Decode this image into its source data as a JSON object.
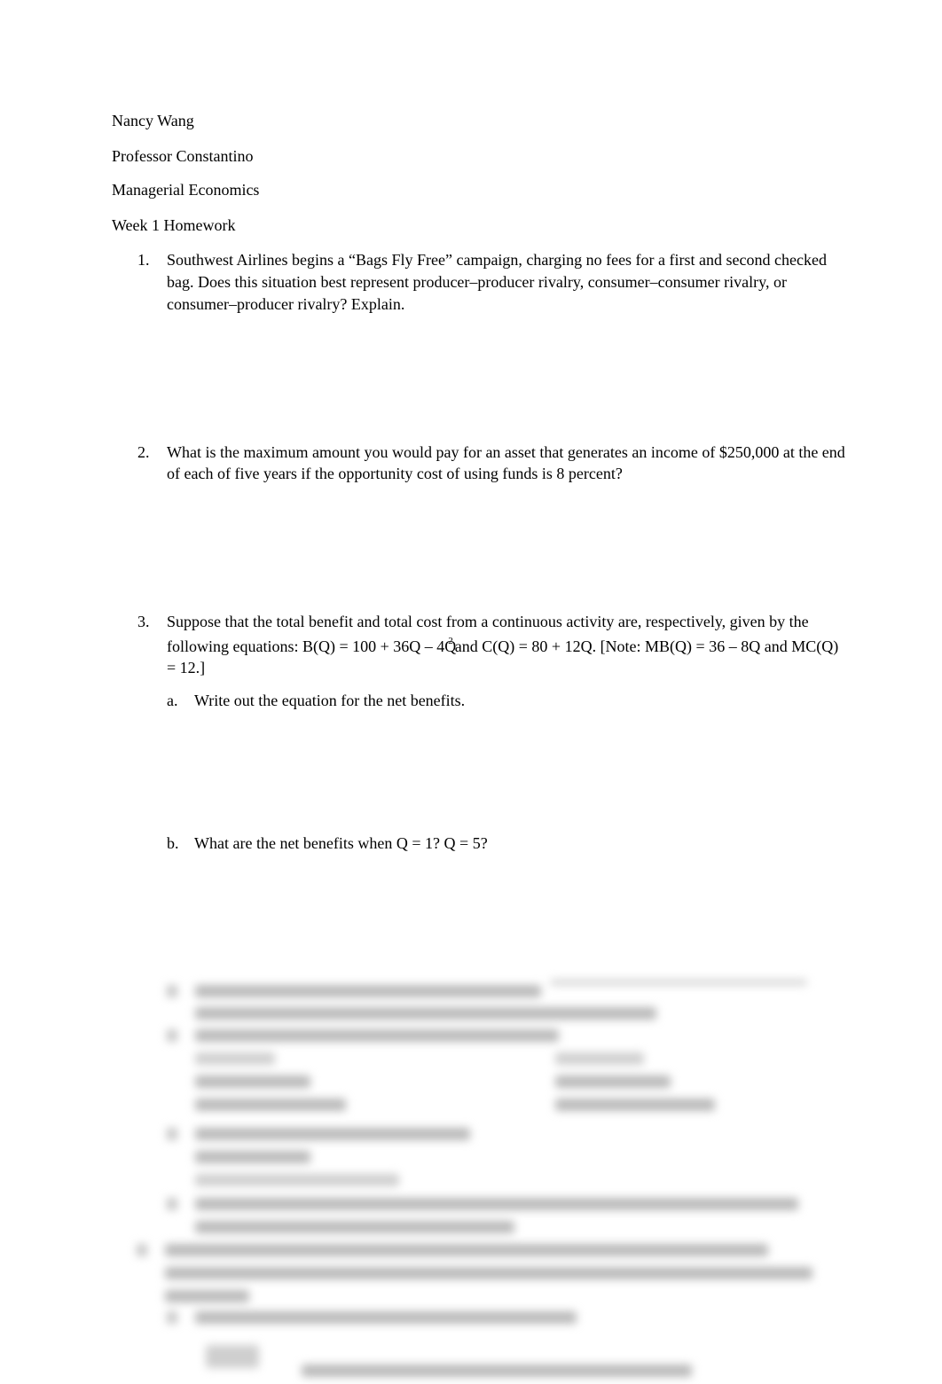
{
  "header": {
    "student_name": "Nancy Wang",
    "professor": "Professor Constantino",
    "course": "Managerial Economics",
    "assignment": "Week 1 Homework"
  },
  "questions": [
    {
      "number": "1.",
      "text": "Southwest Airlines begins a “Bags Fly Free” campaign, charging no fees for a first and second checked bag. Does this situation best represent producer–producer rivalry, consumer–consumer rivalry, or consumer–producer rivalry? Explain."
    },
    {
      "number": "2.",
      "text": "What is the maximum amount you would pay for an asset that generates an income of $250,000 at the end of each of five years if the opportunity cost of using funds is 8 percent?"
    },
    {
      "number": "3.",
      "text_part1": "Suppose that the total benefit and total cost from a continuous activity are, respectively, given by the following equations: B(Q) = 100 + 36Q – 4Q",
      "superscript": "2",
      "text_part2": "and C(Q) = 80 + 12Q. [Note: MB(Q) = 36 – 8Q and MC(Q) = 12.]",
      "parts": [
        {
          "letter": "a.",
          "text": "Write out the equation for the net benefits."
        },
        {
          "letter": "b.",
          "text": "What are the net benefits when Q = 1? Q = 5?"
        }
      ]
    }
  ],
  "obscured_section": {
    "state": "blurred preview"
  }
}
